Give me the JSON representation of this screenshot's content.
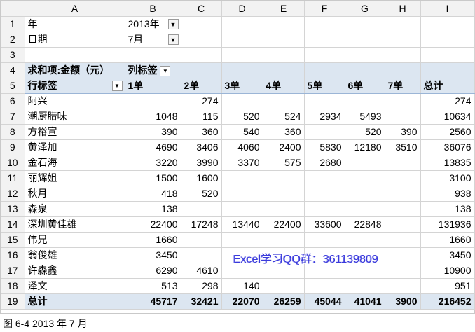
{
  "columns": [
    "A",
    "B",
    "C",
    "D",
    "E",
    "F",
    "G",
    "H",
    "I"
  ],
  "filters": [
    {
      "row": "1",
      "label": "年",
      "value": "2013年"
    },
    {
      "row": "2",
      "label": "日期",
      "value": "7月"
    }
  ],
  "pivot": {
    "data_field": "求和项:金额（元）",
    "column_label": "列标签",
    "row_label": "行标签",
    "headers": [
      "1单",
      "2单",
      "3单",
      "4单",
      "5单",
      "6单",
      "7单",
      "总计"
    ],
    "rows": [
      {
        "row": "6",
        "name": "阿兴",
        "v": [
          "",
          "274",
          "",
          "",
          "",
          "",
          "",
          "274"
        ]
      },
      {
        "row": "7",
        "name": "潮厨腊味",
        "v": [
          "1048",
          "115",
          "520",
          "524",
          "2934",
          "5493",
          "",
          "10634"
        ]
      },
      {
        "row": "8",
        "name": "方裕宣",
        "v": [
          "390",
          "360",
          "540",
          "360",
          "",
          "520",
          "390",
          "2560"
        ]
      },
      {
        "row": "9",
        "name": "黄泽加",
        "v": [
          "4690",
          "3406",
          "4060",
          "2400",
          "5830",
          "12180",
          "3510",
          "36076"
        ]
      },
      {
        "row": "10",
        "name": "金石海",
        "v": [
          "3220",
          "3990",
          "3370",
          "575",
          "2680",
          "",
          "",
          "13835"
        ]
      },
      {
        "row": "11",
        "name": "丽辉姐",
        "v": [
          "1500",
          "1600",
          "",
          "",
          "",
          "",
          "",
          "3100"
        ]
      },
      {
        "row": "12",
        "name": "秋月",
        "v": [
          "418",
          "520",
          "",
          "",
          "",
          "",
          "",
          "938"
        ]
      },
      {
        "row": "13",
        "name": "森泉",
        "v": [
          "138",
          "",
          "",
          "",
          "",
          "",
          "",
          "138"
        ]
      },
      {
        "row": "14",
        "name": "深圳黄佳雄",
        "v": [
          "22400",
          "17248",
          "13440",
          "22400",
          "33600",
          "22848",
          "",
          "131936"
        ]
      },
      {
        "row": "15",
        "name": "伟兄",
        "v": [
          "1660",
          "",
          "",
          "",
          "",
          "",
          "",
          "1660"
        ]
      },
      {
        "row": "16",
        "name": "翁俊雄",
        "v": [
          "3450",
          "",
          "",
          "",
          "",
          "",
          "",
          "3450"
        ]
      },
      {
        "row": "17",
        "name": "许森鑫",
        "v": [
          "6290",
          "4610",
          "",
          "",
          "",
          "",
          "",
          "10900"
        ]
      },
      {
        "row": "18",
        "name": "泽文",
        "v": [
          "513",
          "298",
          "140",
          "",
          "",
          "",
          "",
          "951"
        ]
      }
    ],
    "total": {
      "row": "19",
      "name": "总计",
      "v": [
        "45717",
        "32421",
        "22070",
        "26259",
        "45044",
        "41041",
        "3900",
        "216452"
      ]
    }
  },
  "watermark": "Excel学习QQ群：361139809",
  "caption": "图 6-4 2013 年 7 月",
  "icons": {
    "filter": "filter-funnel-icon",
    "dropdown": "dropdown-arrow-icon"
  }
}
